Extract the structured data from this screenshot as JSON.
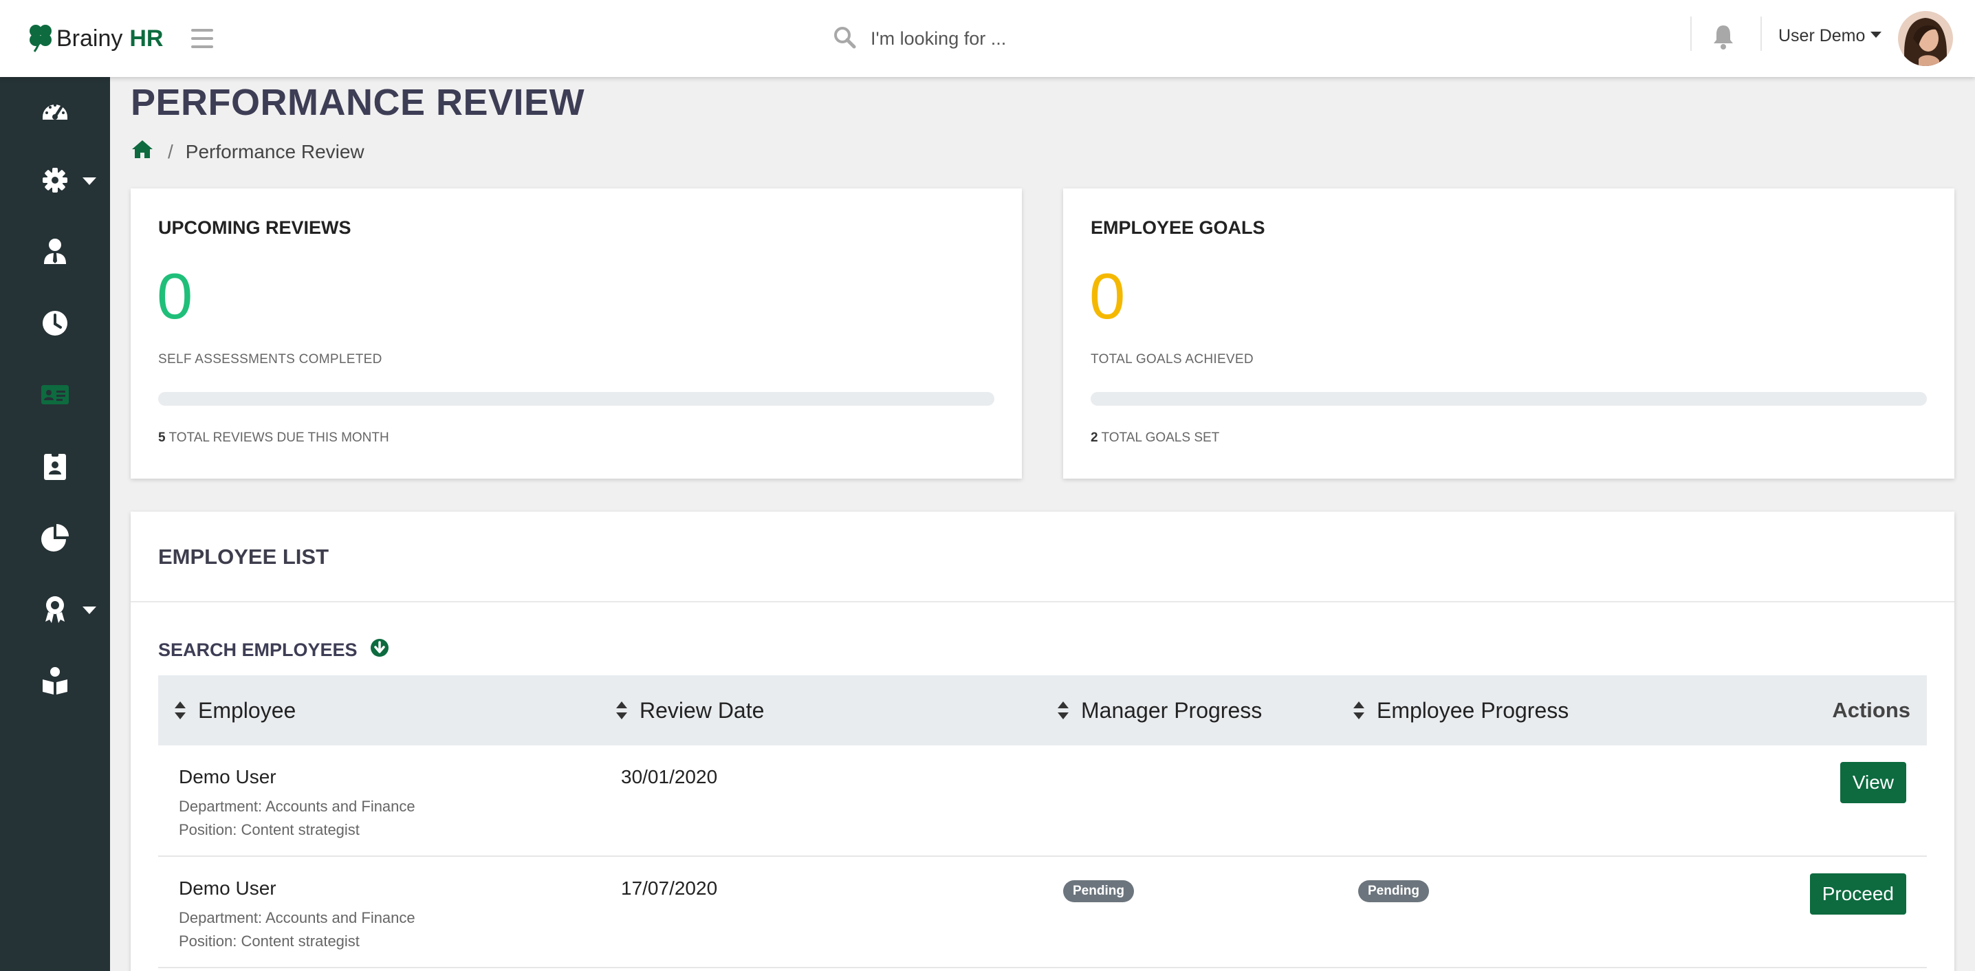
{
  "app": {
    "brand_part1": "Brainy",
    "brand_part2": "HR",
    "accent": "#0d6b3f"
  },
  "topbar": {
    "search_placeholder": "I'm looking for ...",
    "user_name": "User Demo"
  },
  "sidebar": {
    "items": [
      {
        "icon": "tachometer-icon",
        "has_dropdown": false
      },
      {
        "icon": "gear-icon",
        "has_dropdown": true
      },
      {
        "icon": "user-tie-icon",
        "has_dropdown": false
      },
      {
        "icon": "clock-icon",
        "has_dropdown": false
      },
      {
        "icon": "id-card-icon",
        "has_dropdown": false,
        "active": true
      },
      {
        "icon": "id-badge-icon",
        "has_dropdown": false
      },
      {
        "icon": "chart-pie-icon",
        "has_dropdown": false
      },
      {
        "icon": "award-icon",
        "has_dropdown": true
      },
      {
        "icon": "book-reader-icon",
        "has_dropdown": false
      }
    ]
  },
  "page": {
    "title": "PERFORMANCE REVIEW",
    "breadcrumb_current": "Performance Review",
    "breadcrumb_separator": "/"
  },
  "cards": {
    "reviews": {
      "title": "UPCOMING REVIEWS",
      "number": "0",
      "number_color": "#1fbf7a",
      "subtitle": "SELF ASSESSMENTS COMPLETED",
      "progress": 0,
      "footer_count": "5",
      "footer_text": "TOTAL REVIEWS DUE THIS MONTH"
    },
    "goals": {
      "title": "EMPLOYEE GOALS",
      "number": "0",
      "number_color": "#f5b800",
      "subtitle": "TOTAL GOALS ACHIEVED",
      "progress": 0,
      "footer_count": "2",
      "footer_text": "TOTAL GOALS SET"
    }
  },
  "employee_list": {
    "title": "EMPLOYEE LIST",
    "search_label": "SEARCH EMPLOYEES",
    "columns": {
      "employee": "Employee",
      "review_date": "Review Date",
      "manager_progress": "Manager Progress",
      "employee_progress": "Employee Progress",
      "actions": "Actions"
    },
    "rows": [
      {
        "name": "Demo User",
        "department": "Department: Accounts and Finance",
        "position": "Position: Content strategist",
        "review_date": "30/01/2020",
        "manager_progress": "",
        "employee_progress": "",
        "action": "View"
      },
      {
        "name": "Demo User",
        "department": "Department: Accounts and Finance",
        "position": "Position: Content strategist",
        "review_date": "17/07/2020",
        "manager_progress": "Pending",
        "employee_progress": "Pending",
        "action": "Proceed"
      }
    ]
  }
}
